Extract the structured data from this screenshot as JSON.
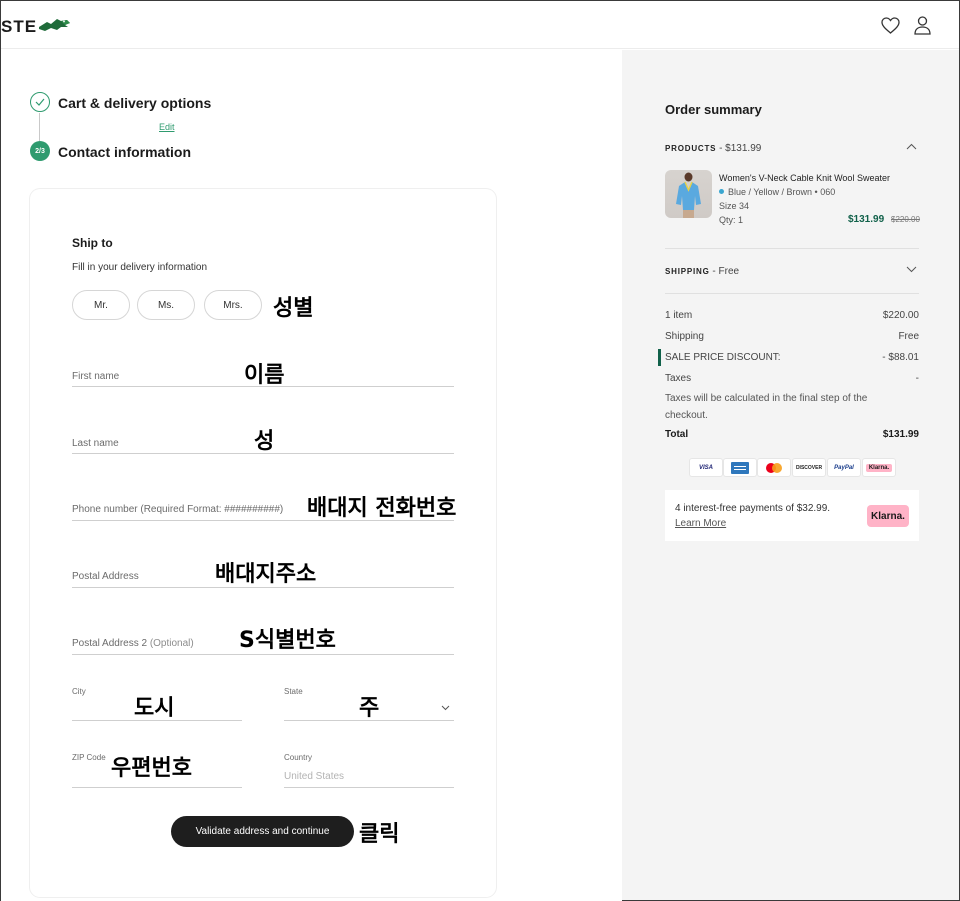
{
  "header": {
    "logo_text": "STE",
    "icons": [
      "crocodile-logo",
      "heart-icon",
      "user-icon"
    ]
  },
  "stepper": {
    "step1": {
      "title": "Cart & delivery options",
      "edit": "Edit"
    },
    "step2": {
      "badge": "2/3",
      "title": "Contact information"
    }
  },
  "form": {
    "title": "Ship to",
    "subtitle": "Fill in your delivery information",
    "titles": [
      "Mr.",
      "Ms.",
      "Mrs."
    ],
    "first_name": "First name",
    "last_name": "Last name",
    "phone": "Phone number (Required Format: ##########)",
    "address": "Postal Address",
    "address2": "Postal Address 2",
    "address2_optional": "(Optional)",
    "city": "City",
    "state": "State",
    "zip": "ZIP Code",
    "country": "Country",
    "country_value": "United States",
    "submit": "Validate address and continue"
  },
  "annotations": {
    "gender": "성별",
    "first_name": "이름",
    "last_name": "성",
    "phone": "배대지 전화번호",
    "address": "배대지주소",
    "address2": "S식별번호",
    "city": "도시",
    "state": "주",
    "zip": "우편번호",
    "click": "클릭"
  },
  "summary": {
    "title": "Order summary",
    "products_label": "PRODUCTS",
    "products_total": " - $131.99",
    "product": {
      "name": "Women's V-Neck Cable Knit Wool Sweater",
      "color": "Blue / Yellow / Brown • 060",
      "size": "Size 34",
      "qty": "Qty: 1",
      "price": "$131.99",
      "old_price": "$220.00"
    },
    "shipping_label": "SHIPPING",
    "shipping_value": " - Free",
    "rows": [
      {
        "label": "1 item",
        "value": "$220.00"
      },
      {
        "label": "Shipping",
        "value": "Free"
      },
      {
        "label": "SALE PRICE DISCOUNT:",
        "value": "- $88.01"
      },
      {
        "label": "Taxes",
        "value": "-"
      }
    ],
    "taxes_note": "Taxes will be calculated in the final step of the checkout.",
    "total_label": "Total",
    "total_value": "$131.99",
    "payments": [
      "VISA",
      "AMEX",
      "MC",
      "DISCOVER",
      "PayPal",
      "Klarna."
    ],
    "klarna": {
      "text": "4 interest-free payments of $32.99.",
      "link": "Learn More",
      "badge": "Klarna."
    }
  },
  "colors": {
    "accent_green": "#2f9b6f",
    "price_green": "#11614a",
    "button_dark": "#1e1e1e",
    "summary_bg": "#f4f4f4",
    "klarna_pink": "#ffb3c7"
  }
}
